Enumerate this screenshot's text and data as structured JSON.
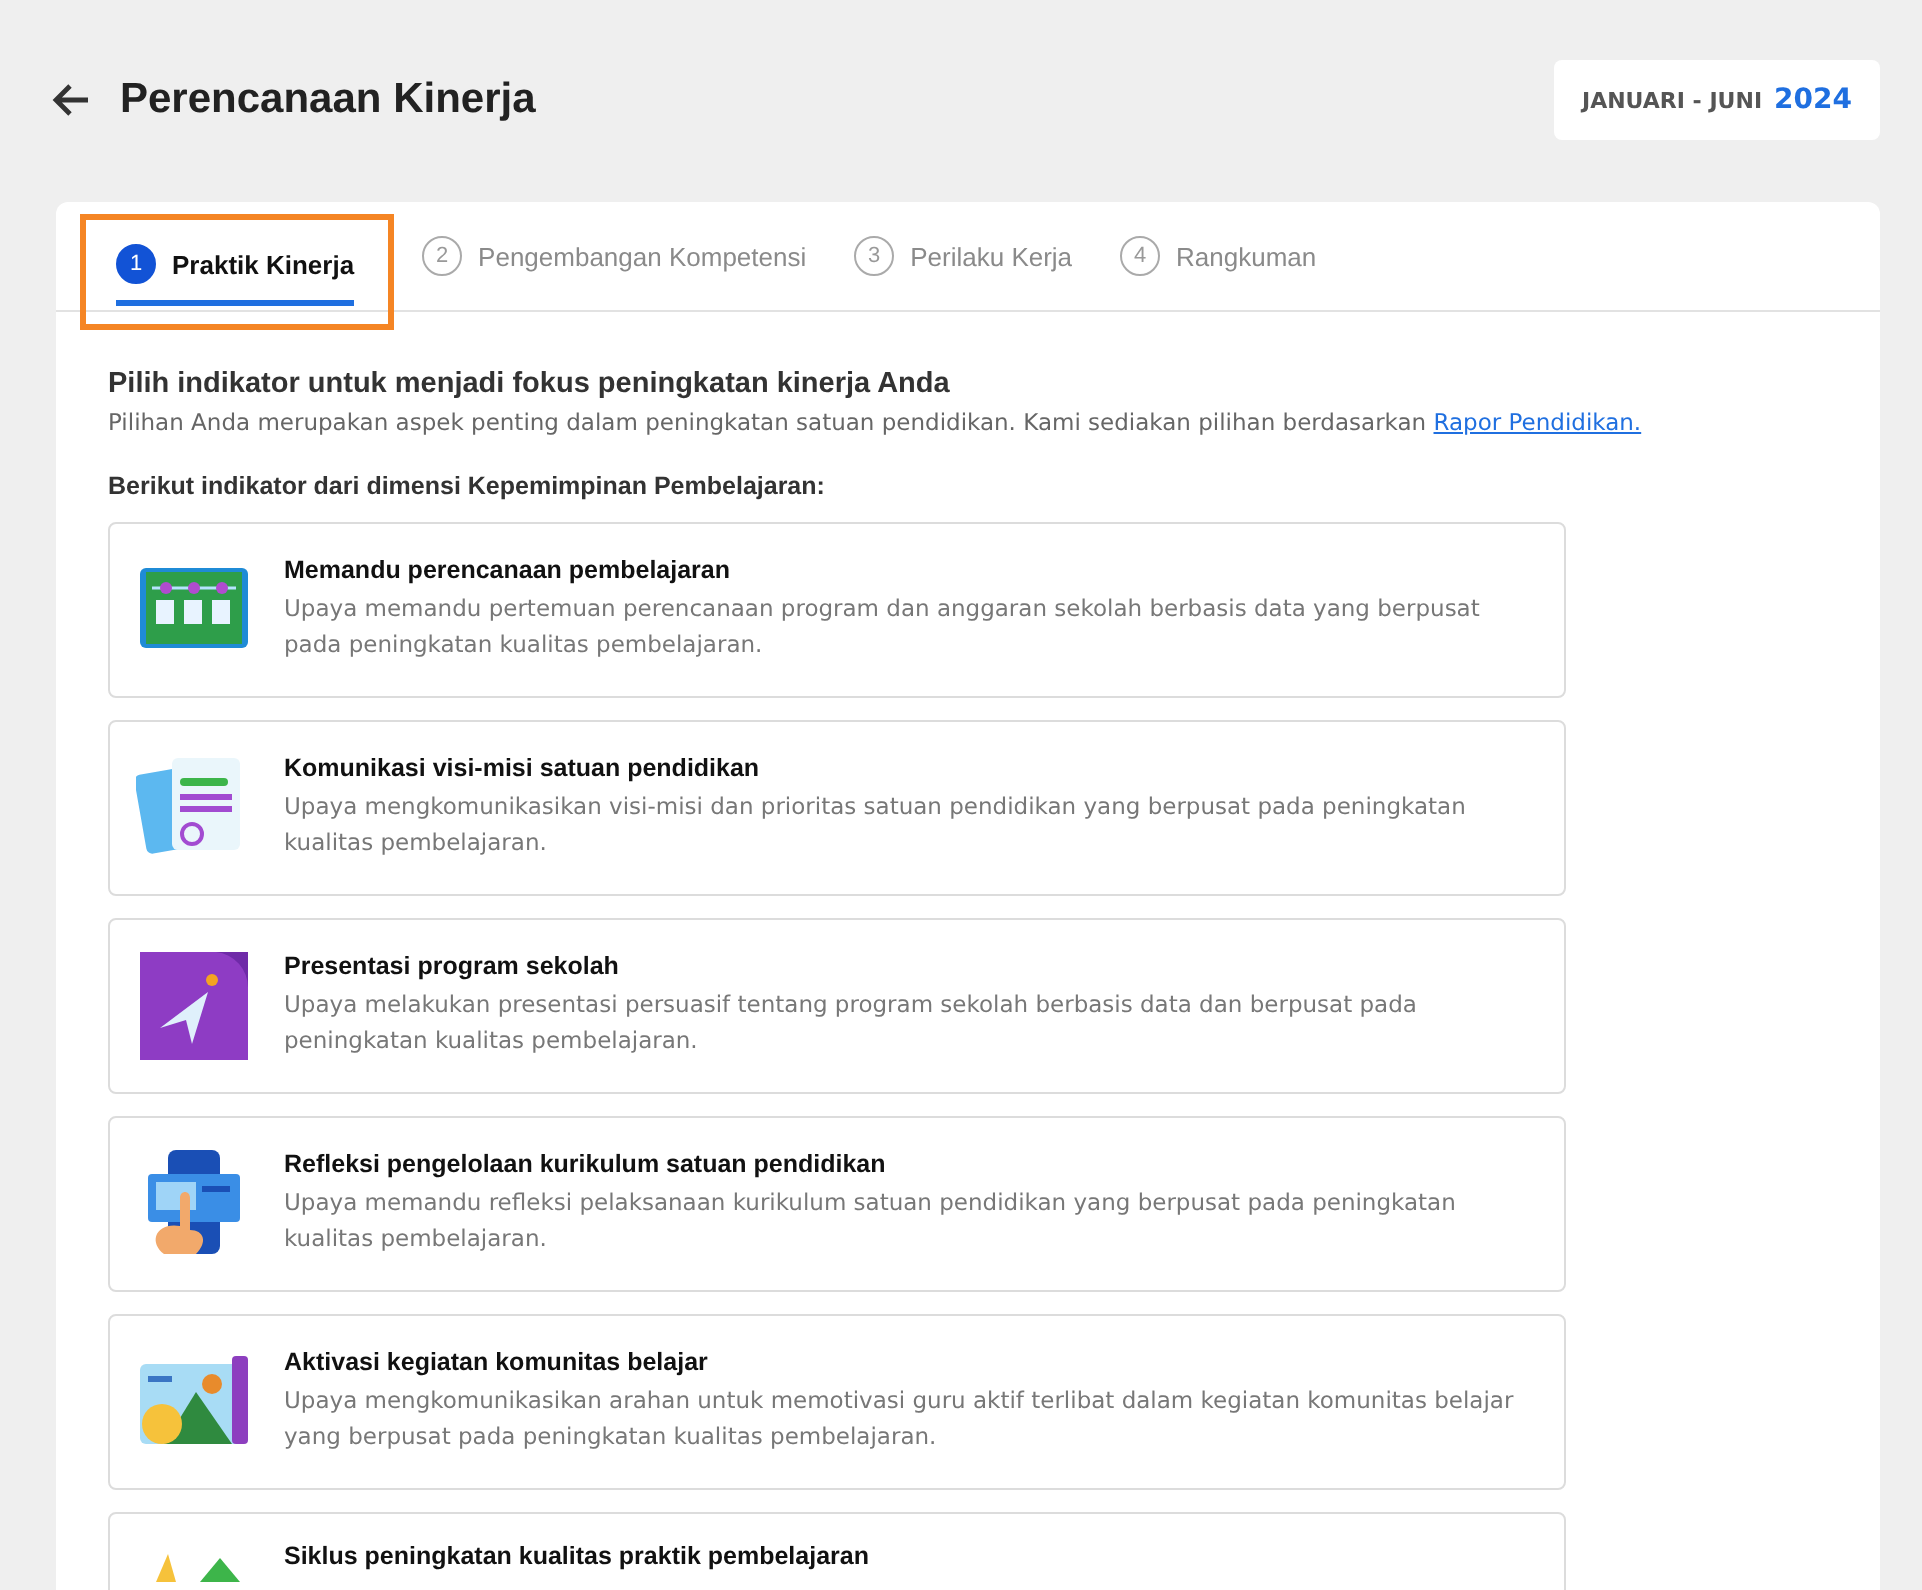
{
  "header": {
    "title": "Perencanaan Kinerja",
    "period": {
      "range": "JANUARI - JUNI",
      "year": "2024"
    }
  },
  "tabs": [
    {
      "number": "1",
      "label": "Praktik Kinerja",
      "selected": true,
      "highlighted": true
    },
    {
      "number": "2",
      "label": "Pengembangan Kompetensi",
      "selected": false,
      "highlighted": false
    },
    {
      "number": "3",
      "label": "Perilaku Kerja",
      "selected": false,
      "highlighted": false
    },
    {
      "number": "4",
      "label": "Rangkuman",
      "selected": false,
      "highlighted": false
    }
  ],
  "intro": {
    "heading": "Pilih indikator untuk menjadi fokus peningkatan kinerja Anda",
    "text": "Pilihan Anda merupakan aspek penting dalam peningkatan satuan pendidikan. Kami sediakan pilihan berdasarkan",
    "link": "Rapor Pendidikan."
  },
  "section_label": "Berikut indikator dari dimensi Kepemimpinan Pembelajaran:",
  "indicators": [
    {
      "title": "Memandu perencanaan pembelajaran",
      "description": "Upaya memandu pertemuan perencanaan program dan anggaran sekolah berbasis data yang berpusat pada peningkatan kualitas pembelajaran."
    },
    {
      "title": "Komunikasi visi-misi satuan pendidikan",
      "description": "Upaya mengkomunikasikan visi-misi dan prioritas satuan pendidikan yang berpusat pada peningkatan kualitas pembelajaran."
    },
    {
      "title": "Presentasi program sekolah",
      "description": "Upaya melakukan presentasi persuasif tentang program sekolah berbasis data dan berpusat pada peningkatan kualitas pembelajaran."
    },
    {
      "title": "Refleksi pengelolaan kurikulum satuan pendidikan",
      "description": "Upaya memandu refleksi pelaksanaan kurikulum satuan pendidikan yang berpusat pada peningkatan kualitas pembelajaran."
    },
    {
      "title": "Aktivasi kegiatan komunitas belajar",
      "description": "Upaya mengkomunikasikan arahan untuk memotivasi guru aktif terlibat dalam kegiatan komunitas belajar yang berpusat pada peningkatan kualitas pembelajaran."
    },
    {
      "title": "Siklus peningkatan kualitas praktik pembelajaran"
    }
  ]
}
